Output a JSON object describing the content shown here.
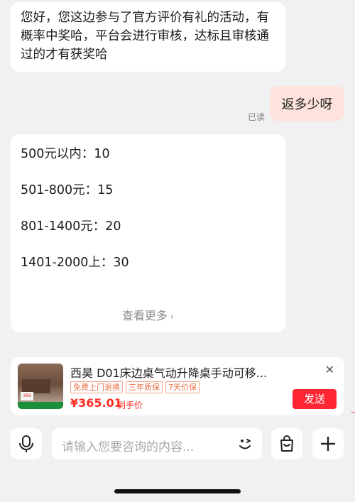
{
  "messages": {
    "reply_text": "您好，您这边参与了官方评价有礼的活动，有概率中奖哈，平台会进行审核，达标且审核通过的才有获奖哈",
    "user_question": "返多少呀",
    "read_status": "已读",
    "price_lines": [
      "500元以内：10",
      "501-800元：15",
      "801-1400元：20",
      "1401-2000上：30"
    ],
    "see_more": "查看更多"
  },
  "product_card": {
    "title": "西昊 D01床边桌气动升降桌手动可移...",
    "badges": [
      "免费上门退换",
      "三年质保",
      "7天价保"
    ],
    "price": "¥365.01",
    "price_label": "到手价",
    "send_label": "发送",
    "thumb_tag": "369"
  },
  "input_bar": {
    "placeholder": "请输入您要咨询的内容..."
  },
  "colors": {
    "accent": "#ff2633",
    "user_bubble": "#fde3dc",
    "background": "#f1f1f3"
  },
  "icons": {
    "mic": "microphone-icon",
    "emoji": "emoji-icon",
    "cart": "shopping-bag-icon",
    "plus": "plus-icon",
    "close": "close-icon",
    "chevron": "chevron-right-icon"
  }
}
